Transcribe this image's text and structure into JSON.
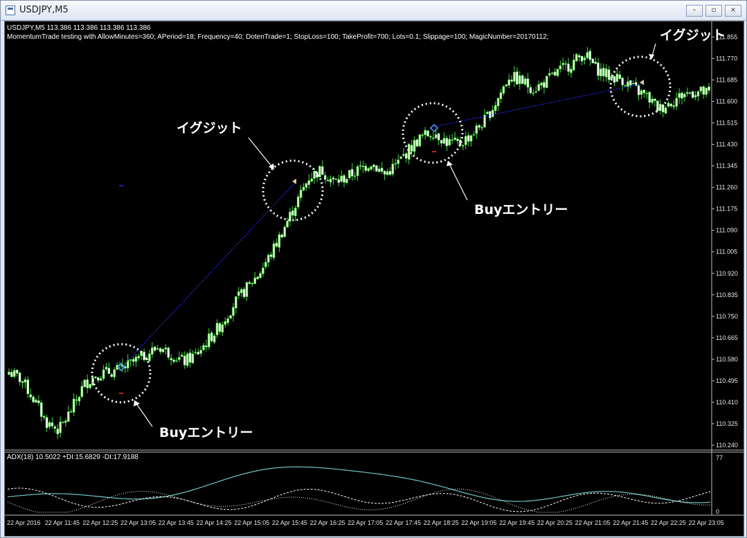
{
  "window": {
    "title": "USDJPY,M5",
    "buttons": [
      "–",
      "▫",
      "×"
    ]
  },
  "header": {
    "quote": "USDJPY,M5  113.386 113.386 113.386 113.386",
    "ea_line": "MomentumTrade testing with AllowMinutes=360; APeriod=18; Frequency=40; DotenTrade=1; StopLoss=100; TakeProfit=700; Lots=0.1; Slippage=100; MagicNumber=20170112;"
  },
  "price_axis": [
    "111.855",
    "111.770",
    "111.685",
    "111.600",
    "111.515",
    "111.430",
    "111.345",
    "111.260",
    "111.175",
    "111.090",
    "111.005",
    "110.920",
    "110.835",
    "110.750",
    "110.665",
    "110.580",
    "110.495",
    "110.410",
    "110.325",
    "110.240"
  ],
  "time_axis": [
    "22 Apr 2016",
    "22 Apr 11:45",
    "22 Apr 12:25",
    "22 Apr 13:05",
    "22 Apr 13:45",
    "22 Apr 14:25",
    "22 Apr 15:05",
    "22 Apr 15:45",
    "22 Apr 16:25",
    "22 Apr 17:05",
    "22 Apr 17:45",
    "22 Apr 18:25",
    "22 Apr 19:05",
    "22 Apr 19:45",
    "22 Apr 20:25",
    "22 Apr 21:05",
    "22 Apr 21:45",
    "22 Apr 22:25",
    "22 Apr 23:05"
  ],
  "indicator": {
    "label": "ADX(18) 10.5022 +DI:15.6829 -DI:17.9188",
    "max_label": "77",
    "min_label": "0"
  },
  "annotations": {
    "exit_1": "イグジット",
    "exit_2": "イグジット",
    "buy_1": "Buyエントリー",
    "buy_2": "Buyエントリー"
  },
  "colors": {
    "background": "#000000",
    "bull_candle": "#c8ffb0",
    "bear_candle": "#ffffff",
    "wick": "#44dd44",
    "trade_line": "#2a2aff",
    "adx_line": "#6fc7c7",
    "di_lines": "#ffffff"
  },
  "chart_data": {
    "type": "candlestick",
    "instrument": "USDJPY",
    "timeframe": "M5",
    "ylim": [
      110.24,
      111.9
    ],
    "close_path_approx": [
      110.53,
      110.5,
      110.42,
      110.33,
      110.3,
      110.38,
      110.48,
      110.52,
      110.53,
      110.54,
      110.57,
      110.6,
      110.63,
      110.6,
      110.57,
      110.6,
      110.66,
      110.72,
      110.8,
      110.86,
      110.92,
      111.0,
      111.1,
      111.2,
      111.3,
      111.33,
      111.28,
      111.3,
      111.33,
      111.36,
      111.31,
      111.35,
      111.41,
      111.46,
      111.48,
      111.44,
      111.43,
      111.47,
      111.52,
      111.6,
      111.7,
      111.68,
      111.65,
      111.68,
      111.72,
      111.75,
      111.79,
      111.73,
      111.7,
      111.69,
      111.65,
      111.62,
      111.57,
      111.6,
      111.63,
      111.64,
      111.63
    ]
  }
}
